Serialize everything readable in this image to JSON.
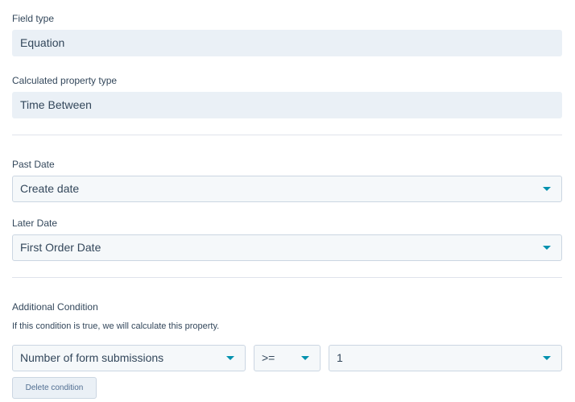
{
  "field_type": {
    "label": "Field type",
    "value": "Equation"
  },
  "calculated_property_type": {
    "label": "Calculated property type",
    "value": "Time Between"
  },
  "past_date": {
    "label": "Past Date",
    "value": "Create date"
  },
  "later_date": {
    "label": "Later Date",
    "value": "First Order Date"
  },
  "additional_condition": {
    "label": "Additional Condition",
    "help": "If this condition is true, we will calculate this property.",
    "property": "Number of form submissions",
    "operator": ">=",
    "value": "1",
    "delete_label": "Delete condition"
  },
  "icons": {
    "dropdown": "caret-down-icon"
  },
  "colors": {
    "text": "#33475b",
    "readonly_bg": "#eaf0f6",
    "select_bg": "#f5f8fa",
    "border": "#cbd6e2",
    "caret": "#0091ae",
    "divider": "#dfe3eb"
  }
}
